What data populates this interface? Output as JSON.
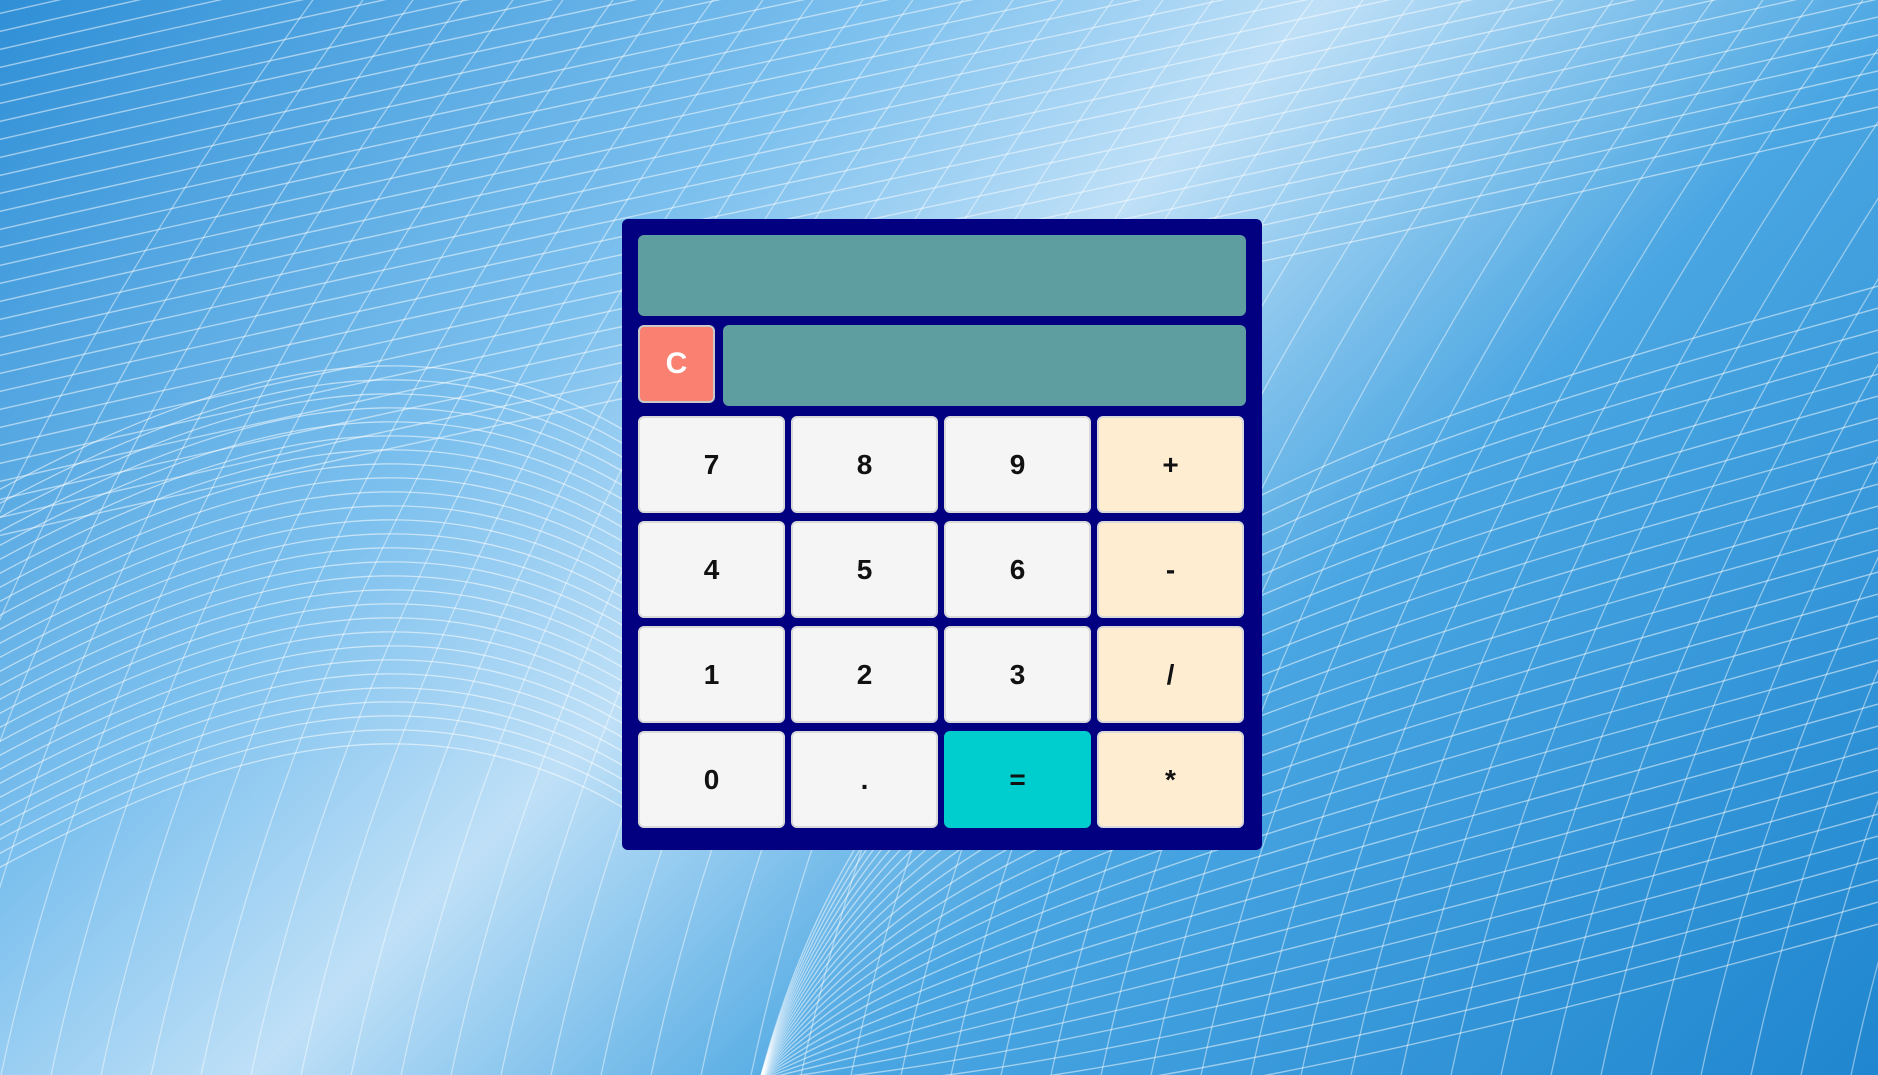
{
  "calculator": {
    "display_top": "",
    "display_bottom": "",
    "clear_label": "C",
    "keys": [
      {
        "label": "7",
        "kind": "digit"
      },
      {
        "label": "8",
        "kind": "digit"
      },
      {
        "label": "9",
        "kind": "digit"
      },
      {
        "label": "+",
        "kind": "op"
      },
      {
        "label": "4",
        "kind": "digit"
      },
      {
        "label": "5",
        "kind": "digit"
      },
      {
        "label": "6",
        "kind": "digit"
      },
      {
        "label": "-",
        "kind": "op"
      },
      {
        "label": "1",
        "kind": "digit"
      },
      {
        "label": "2",
        "kind": "digit"
      },
      {
        "label": "3",
        "kind": "digit"
      },
      {
        "label": "/",
        "kind": "op"
      },
      {
        "label": "0",
        "kind": "digit"
      },
      {
        "label": ".",
        "kind": "digit"
      },
      {
        "label": "=",
        "kind": "equals"
      },
      {
        "label": "*",
        "kind": "op"
      }
    ]
  },
  "colors": {
    "frame": "#020080",
    "display": "#5f9ea0",
    "clear": "#fa8072",
    "digit_key": "#f5f5f5",
    "operator_key": "#ffedd2",
    "equals_key": "#00cdcd"
  }
}
